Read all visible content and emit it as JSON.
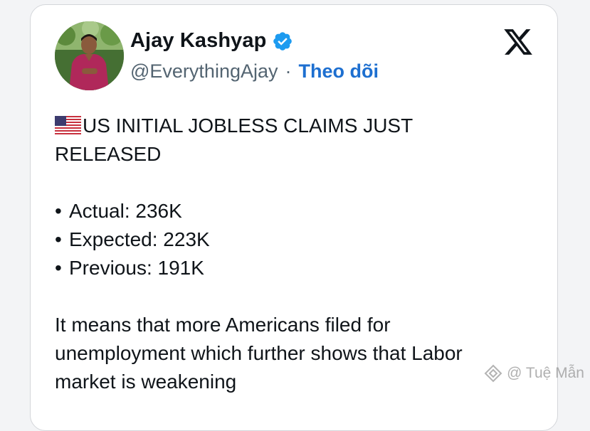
{
  "tweet": {
    "author": {
      "display_name": "Ajay Kashyap",
      "handle": "@EverythingAjay",
      "separator": "·",
      "follow_label": "Theo dõi",
      "verified": true,
      "avatar_icon": "profile-photo"
    },
    "platform_icon": "x-logo-icon",
    "flag_icon": "us-flag-icon",
    "text": {
      "headline_line1": "US INITIAL JOBLESS CLAIMS  JUST",
      "headline_line2": "RELEASED",
      "bullets": [
        "Actual: 236K",
        "Expected: 223K",
        "Previous: 191K"
      ],
      "bullet_char": "•",
      "body_lines": [
        "It means that more Americans filed for",
        "unemployment which further shows that Labor",
        "market is weakening"
      ]
    }
  },
  "watermark": {
    "text": "@ Tuệ Mẫn"
  },
  "colors": {
    "verified_badge": "#1d9bf0",
    "follow_link": "#1d6fd0",
    "handle": "#536471",
    "text": "#0f1419"
  }
}
